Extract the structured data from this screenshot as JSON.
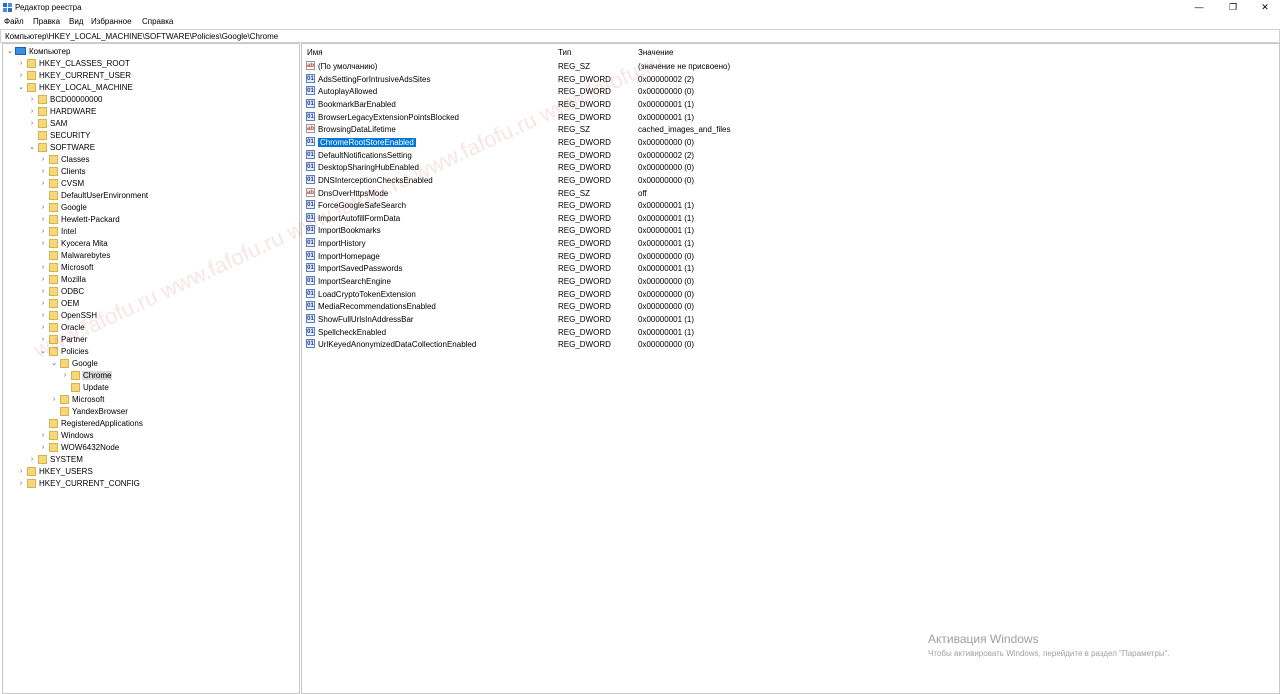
{
  "window": {
    "title": "Редактор реестра",
    "minimize_glyph": "—",
    "restore_glyph": "❐",
    "close_glyph": "✕"
  },
  "menu": [
    "Файл",
    "Правка",
    "Вид",
    "Избранное",
    "Справка"
  ],
  "address": "Компьютер\\HKEY_LOCAL_MACHINE\\SOFTWARE\\Policies\\Google\\Chrome",
  "tree": [
    {
      "label": "Компьютер",
      "level": 0,
      "expanded": true,
      "type": "computer"
    },
    {
      "label": "HKEY_CLASSES_ROOT",
      "level": 1,
      "expanded": false
    },
    {
      "label": "HKEY_CURRENT_USER",
      "level": 1,
      "expanded": false
    },
    {
      "label": "HKEY_LOCAL_MACHINE",
      "level": 1,
      "expanded": true
    },
    {
      "label": "BCD00000000",
      "level": 2,
      "expanded": false
    },
    {
      "label": "HARDWARE",
      "level": 2,
      "expanded": false
    },
    {
      "label": "SAM",
      "level": 2,
      "expanded": false
    },
    {
      "label": "SECURITY",
      "level": 2,
      "expanded": null
    },
    {
      "label": "SOFTWARE",
      "level": 2,
      "expanded": true
    },
    {
      "label": "Classes",
      "level": 3,
      "expanded": false
    },
    {
      "label": "Clients",
      "level": 3,
      "expanded": false
    },
    {
      "label": "CVSM",
      "level": 3,
      "expanded": false
    },
    {
      "label": "DefaultUserEnvironment",
      "level": 3,
      "expanded": null
    },
    {
      "label": "Google",
      "level": 3,
      "expanded": false
    },
    {
      "label": "Hewlett-Packard",
      "level": 3,
      "expanded": false
    },
    {
      "label": "Intel",
      "level": 3,
      "expanded": false
    },
    {
      "label": "Kyocera Mita",
      "level": 3,
      "expanded": false
    },
    {
      "label": "Malwarebytes",
      "level": 3,
      "expanded": null
    },
    {
      "label": "Microsoft",
      "level": 3,
      "expanded": false
    },
    {
      "label": "Mozilla",
      "level": 3,
      "expanded": false
    },
    {
      "label": "ODBC",
      "level": 3,
      "expanded": false
    },
    {
      "label": "OEM",
      "level": 3,
      "expanded": false
    },
    {
      "label": "OpenSSH",
      "level": 3,
      "expanded": false
    },
    {
      "label": "Oracle",
      "level": 3,
      "expanded": false
    },
    {
      "label": "Partner",
      "level": 3,
      "expanded": false
    },
    {
      "label": "Policies",
      "level": 3,
      "expanded": true
    },
    {
      "label": "Google",
      "level": 4,
      "expanded": true
    },
    {
      "label": "Chrome",
      "level": 5,
      "expanded": false,
      "selected": true
    },
    {
      "label": "Update",
      "level": 5,
      "expanded": null
    },
    {
      "label": "Microsoft",
      "level": 4,
      "expanded": false
    },
    {
      "label": "YandexBrowser",
      "level": 4,
      "expanded": null
    },
    {
      "label": "RegisteredApplications",
      "level": 3,
      "expanded": null
    },
    {
      "label": "Windows",
      "level": 3,
      "expanded": false
    },
    {
      "label": "WOW6432Node",
      "level": 3,
      "expanded": false
    },
    {
      "label": "SYSTEM",
      "level": 2,
      "expanded": false
    },
    {
      "label": "HKEY_USERS",
      "level": 1,
      "expanded": false
    },
    {
      "label": "HKEY_CURRENT_CONFIG",
      "level": 1,
      "expanded": false
    }
  ],
  "columns": {
    "name": "Имя",
    "type": "Тип",
    "data": "Значение"
  },
  "values": [
    {
      "name": "(По умолчанию)",
      "type": "REG_SZ",
      "data": "(значение не присвоено)",
      "kind": "sz"
    },
    {
      "name": "AdsSettingForIntrusiveAdsSites",
      "type": "REG_DWORD",
      "data": "0x00000002 (2)",
      "kind": "dword"
    },
    {
      "name": "AutoplayAllowed",
      "type": "REG_DWORD",
      "data": "0x00000000 (0)",
      "kind": "dword"
    },
    {
      "name": "BookmarkBarEnabled",
      "type": "REG_DWORD",
      "data": "0x00000001 (1)",
      "kind": "dword"
    },
    {
      "name": "BrowserLegacyExtensionPointsBlocked",
      "type": "REG_DWORD",
      "data": "0x00000001 (1)",
      "kind": "dword"
    },
    {
      "name": "BrowsingDataLifetime",
      "type": "REG_SZ",
      "data": "cached_images_and_files",
      "kind": "sz"
    },
    {
      "name": "ChromeRootStoreEnabled",
      "type": "REG_DWORD",
      "data": "0x00000000 (0)",
      "kind": "dword",
      "selected": true
    },
    {
      "name": "DefaultNotificationsSetting",
      "type": "REG_DWORD",
      "data": "0x00000002 (2)",
      "kind": "dword"
    },
    {
      "name": "DesktopSharingHubEnabled",
      "type": "REG_DWORD",
      "data": "0x00000000 (0)",
      "kind": "dword"
    },
    {
      "name": "DNSInterceptionChecksEnabled",
      "type": "REG_DWORD",
      "data": "0x00000000 (0)",
      "kind": "dword"
    },
    {
      "name": "DnsOverHttpsMode",
      "type": "REG_SZ",
      "data": "off",
      "kind": "sz"
    },
    {
      "name": "ForceGoogleSafeSearch",
      "type": "REG_DWORD",
      "data": "0x00000001 (1)",
      "kind": "dword"
    },
    {
      "name": "ImportAutofillFormData",
      "type": "REG_DWORD",
      "data": "0x00000001 (1)",
      "kind": "dword"
    },
    {
      "name": "ImportBookmarks",
      "type": "REG_DWORD",
      "data": "0x00000001 (1)",
      "kind": "dword"
    },
    {
      "name": "ImportHistory",
      "type": "REG_DWORD",
      "data": "0x00000001 (1)",
      "kind": "dword"
    },
    {
      "name": "ImportHomepage",
      "type": "REG_DWORD",
      "data": "0x00000000 (0)",
      "kind": "dword"
    },
    {
      "name": "ImportSavedPasswords",
      "type": "REG_DWORD",
      "data": "0x00000001 (1)",
      "kind": "dword"
    },
    {
      "name": "ImportSearchEngine",
      "type": "REG_DWORD",
      "data": "0x00000000 (0)",
      "kind": "dword"
    },
    {
      "name": "LoadCryptoTokenExtension",
      "type": "REG_DWORD",
      "data": "0x00000000 (0)",
      "kind": "dword"
    },
    {
      "name": "MediaRecommendationsEnabled",
      "type": "REG_DWORD",
      "data": "0x00000000 (0)",
      "kind": "dword"
    },
    {
      "name": "ShowFullUrlsInAddressBar",
      "type": "REG_DWORD",
      "data": "0x00000001 (1)",
      "kind": "dword"
    },
    {
      "name": "SpellcheckEnabled",
      "type": "REG_DWORD",
      "data": "0x00000001 (1)",
      "kind": "dword"
    },
    {
      "name": "UrlKeyedAnonymizedDataCollectionEnabled",
      "type": "REG_DWORD",
      "data": "0x00000000 (0)",
      "kind": "dword"
    }
  ],
  "icon_text": {
    "sz": "ab",
    "dword": "01"
  },
  "watermark": "www.fafofu.ru www.fafofu.ru www.fafofu.ru www.fafofu.ru www.fafofu.ru",
  "activation": {
    "title": "Активация Windows",
    "subtitle": "Чтобы активировать Windows, перейдите в раздел \"Параметры\"."
  }
}
